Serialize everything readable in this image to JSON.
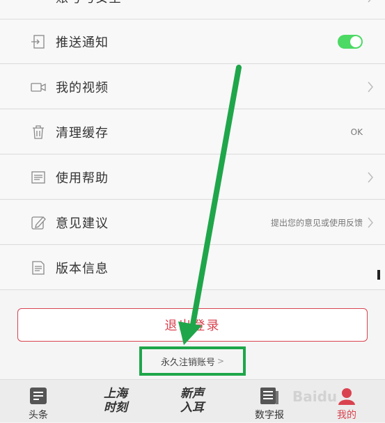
{
  "settings": {
    "rows": [
      {
        "label": "账号与安全",
        "trailing": "chevron"
      },
      {
        "label": "推送通知",
        "trailing": "toggle",
        "toggle_on": true
      },
      {
        "label": "我的视频",
        "trailing": "chevron"
      },
      {
        "label": "清理缓存",
        "trailing": "value",
        "value": "OK"
      },
      {
        "label": "使用帮助",
        "trailing": "chevron"
      },
      {
        "label": "意见建议",
        "trailing": "value-chevron",
        "value": "提出您的意见或使用反馈"
      },
      {
        "label": "版本信息",
        "trailing": "none"
      }
    ]
  },
  "logout_label": "退出登录",
  "cancel_account": {
    "label": "永久注销账号",
    "arrow": ">"
  },
  "tabbar": {
    "tabs": [
      {
        "label": "头条",
        "icon": "news-icon"
      },
      {
        "label": "上海\n时刻",
        "icon": "shanghai-moment-logo"
      },
      {
        "label": "新声\n入耳",
        "icon": "new-voice-logo"
      },
      {
        "label": "数字报",
        "icon": "digital-paper-icon"
      },
      {
        "label": "我的",
        "icon": "profile-icon",
        "active": true
      }
    ]
  },
  "colors": {
    "accent_red": "#d9434f",
    "toggle_green": "#4cd964",
    "highlight_green": "#1fa64a"
  },
  "watermark": "Baidu"
}
